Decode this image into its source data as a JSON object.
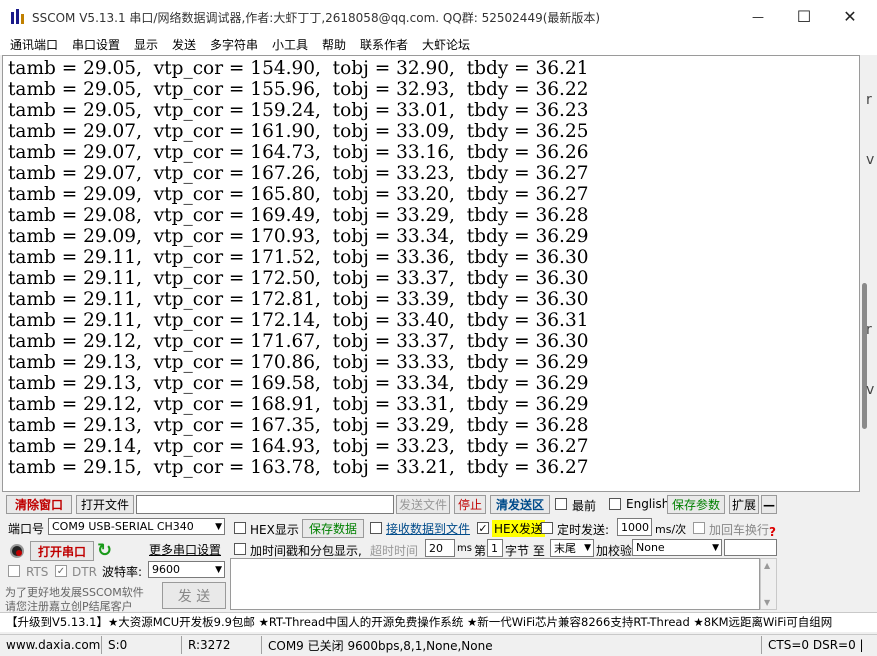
{
  "window": {
    "title": "SSCOM V5.13.1 串口/网络数据调试器,作者:大虾丁丁,2618058@qq.com. QQ群: 52502449(最新版本)",
    "minimize": "—",
    "maximize": "☐",
    "close": "✕"
  },
  "menu": [
    "通讯端口",
    "串口设置",
    "显示",
    "发送",
    "多字符串",
    "小工具",
    "帮助",
    "联系作者",
    "大虾论坛"
  ],
  "output": {
    "lines": [
      "tamb = 29.05,  vtp_cor = 154.90,  tobj = 32.90,  tbdy = 36.21",
      "tamb = 29.05,  vtp_cor = 155.96,  tobj = 32.93,  tbdy = 36.22",
      "tamb = 29.05,  vtp_cor = 159.24,  tobj = 33.01,  tbdy = 36.23",
      "tamb = 29.07,  vtp_cor = 161.90,  tobj = 33.09,  tbdy = 36.25",
      "tamb = 29.07,  vtp_cor = 164.73,  tobj = 33.16,  tbdy = 36.26",
      "tamb = 29.07,  vtp_cor = 167.26,  tobj = 33.23,  tbdy = 36.27",
      "tamb = 29.09,  vtp_cor = 165.80,  tobj = 33.20,  tbdy = 36.27",
      "tamb = 29.08,  vtp_cor = 169.49,  tobj = 33.29,  tbdy = 36.28",
      "tamb = 29.09,  vtp_cor = 170.93,  tobj = 33.34,  tbdy = 36.29",
      "tamb = 29.11,  vtp_cor = 171.52,  tobj = 33.36,  tbdy = 36.30",
      "tamb = 29.11,  vtp_cor = 172.50,  tobj = 33.37,  tbdy = 36.30",
      "tamb = 29.11,  vtp_cor = 172.81,  tobj = 33.39,  tbdy = 36.30",
      "tamb = 29.11,  vtp_cor = 172.14,  tobj = 33.40,  tbdy = 36.31",
      "tamb = 29.12,  vtp_cor = 171.67,  tobj = 33.37,  tbdy = 36.30",
      "tamb = 29.13,  vtp_cor = 170.86,  tobj = 33.33,  tbdy = 36.29",
      "tamb = 29.13,  vtp_cor = 169.58,  tobj = 33.34,  tbdy = 36.29",
      "tamb = 29.12,  vtp_cor = 168.91,  tobj = 33.31,  tbdy = 36.29",
      "tamb = 29.13,  vtp_cor = 167.35,  tobj = 33.29,  tbdy = 36.28",
      "tamb = 29.14,  vtp_cor = 164.93,  tobj = 33.23,  tbdy = 36.27",
      "tamb = 29.15,  vtp_cor = 163.78,  tobj = 33.21,  tbdy = 36.27"
    ]
  },
  "side_marks": [
    "r",
    "v",
    "r",
    "v"
  ],
  "toolbar": {
    "clear_window": "清除窗口",
    "open_file": "打开文件",
    "send_file": "发送文件",
    "stop": "停止",
    "clear_send": "清发送区",
    "topmost": "最前",
    "english": "English",
    "save_params": "保存参数",
    "expand": "扩展",
    "collapse": "—"
  },
  "port": {
    "label": "端口号",
    "value": "COM9 USB-SERIAL CH340",
    "open_button": "打开串口",
    "more_settings": "更多串口设置",
    "rts": "RTS",
    "dtr": "DTR",
    "baud_label": "波特率:",
    "baud_value": "9600"
  },
  "options": {
    "hex_display": "HEX显示",
    "save_data": "保存数据",
    "recv_to_file": "接收数据到文件",
    "hex_send": "HEX发送",
    "timed_send": "定时发送:",
    "interval_value": "1000",
    "interval_unit": "ms/次",
    "add_crlf": "加回车换行",
    "timestamp": "加时间戳和分包显示,",
    "timeout_label": "超时时间",
    "timeout_value": "20",
    "timeout_unit": "ms",
    "nth_label": "第",
    "nth_value": "1",
    "byte_to": "字节 至",
    "end_value": "末尾",
    "checksum_label": "加校验",
    "checksum_value": "None"
  },
  "send": {
    "promo_line1": "为了更好地发展SSCOM软件",
    "promo_line2": "请您注册嘉立创P结尾客户",
    "send_button": "发 送"
  },
  "banner": "【升级到V5.13.1】★大资源MCU开发板9.9包邮 ★RT-Thread中国人的开源免费操作系统 ★新一代WiFi芯片兼容8266支持RT-Thread ★8KM远距离WiFi可自组网",
  "status": {
    "site": "www.daxia.com",
    "sent": "S:0",
    "received": "R:3272",
    "port_state": "COM9 已关闭  9600bps,8,1,None,None",
    "signals": "CTS=0 DSR=0 |"
  },
  "colors": {
    "red_text": "#c00000",
    "blue_text": "#0000cc",
    "green_text": "#008000",
    "hex_send_highlight": "#ffff00"
  }
}
